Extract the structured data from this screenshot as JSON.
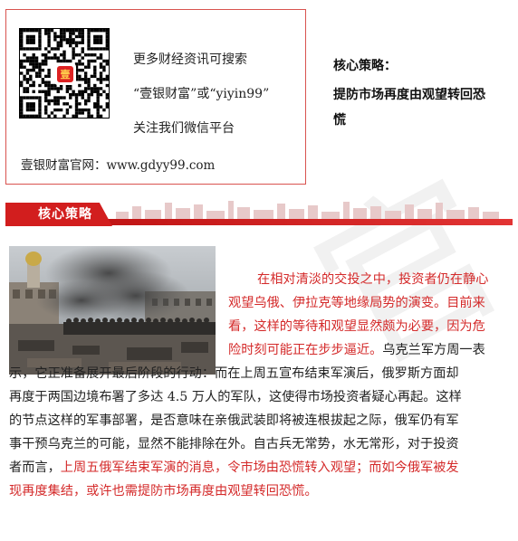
{
  "promo": {
    "line1": "更多财经资讯可搜索",
    "line2": "“壹银财富”或“yiyin99”",
    "line3": "关注我们微信平台",
    "website": "壹银财富官网：www.gdyy99.com"
  },
  "side": {
    "heading": "核心策略：",
    "subtitle_line1": "提防市场再度由观望转回恐",
    "subtitle_line2": "慌"
  },
  "section": {
    "title": "核心策略"
  },
  "watermark": "官",
  "article": {
    "lines": [
      [
        {
          "t": "在相对清淡的交投之中，投资者仍在静心",
          "red": true
        }
      ],
      [
        {
          "t": "观望乌俄、伊拉克等地缘局势的演变。目前来",
          "red": true
        }
      ],
      [
        {
          "t": "看，这样的等待和观望显然颇为必要，因为危",
          "red": true
        }
      ],
      [
        {
          "t": "险时刻可能正在步步逼近。",
          "red": true
        },
        {
          "t": "乌克兰军方周一表",
          "red": false
        }
      ],
      [
        {
          "t": "示，它正准备展开最后阶段的行动：而在上周五宣布结束军演后，俄罗斯方面却",
          "red": false
        }
      ],
      [
        {
          "t": "再度于两国边境布署了多达 4.5 万人的军队，这使得市场投资者疑心再起。这样",
          "red": false
        }
      ],
      [
        {
          "t": "的节点这样的军事部署，是否意味在亲俄武装即将被连根拔起之际，俄军仍有军",
          "red": false
        }
      ],
      [
        {
          "t": "事干预乌克兰的可能，显然不能排除在外。自古兵无常势，水无常形，对于投资",
          "red": false
        }
      ],
      [
        {
          "t": "者而言，",
          "red": false
        },
        {
          "t": "上周五俄军结束军演的消息，令市场由恐慌转入观望；而如今俄军被发",
          "red": true
        }
      ],
      [
        {
          "t": "现再度集结，或许也需提防市场再度由观望转回恐慌。",
          "red": true
        }
      ]
    ]
  },
  "colors": {
    "accent": "#d21e1e",
    "text": "#222222",
    "highlight": "#d42a2a"
  }
}
